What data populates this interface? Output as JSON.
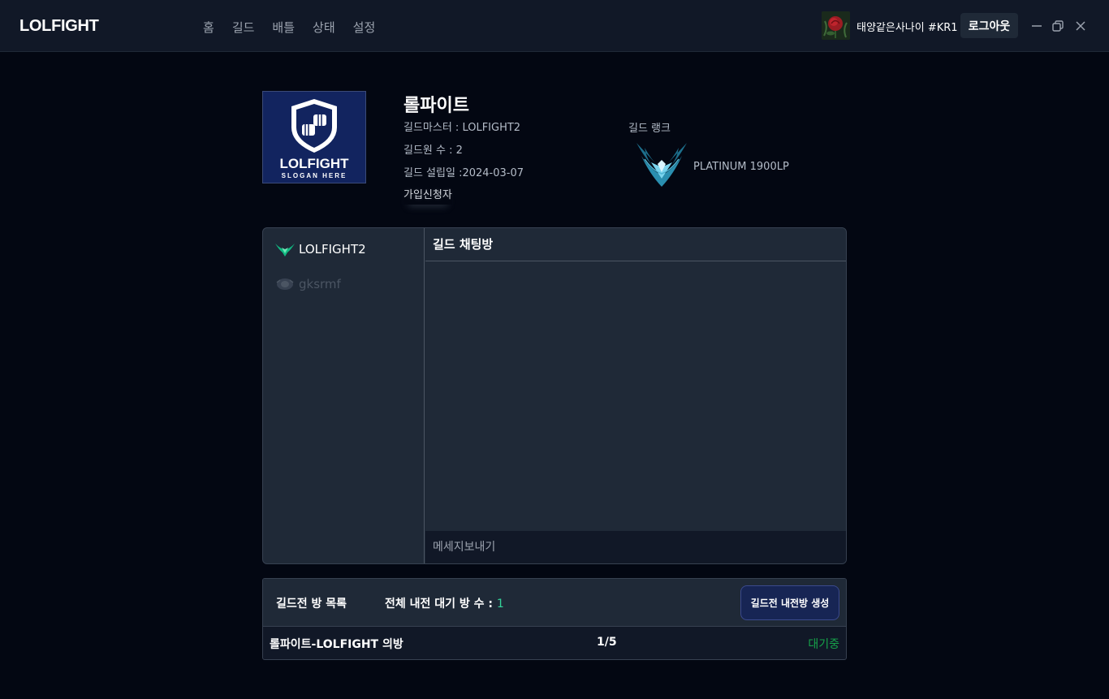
{
  "app": {
    "brand": "LOLFIGHT",
    "nav": [
      "홈",
      "길드",
      "배틀",
      "상태",
      "설정"
    ]
  },
  "user": {
    "name": "태양같은사나이 #KR1",
    "logout_label": "로그아웃"
  },
  "guild": {
    "name": "롤파이트",
    "master": "길드마스터 : LOLFIGHT2",
    "member_count": "길드원 수 : 2",
    "founded": "길드 설립일 :2024-03-07",
    "apply_label": "가입신청자",
    "logo_title": "LOLFIGHT",
    "logo_slogan": "SLOGAN HERE",
    "rank_label": "길드 랭크",
    "rank_value": "PLATINUM 1900LP"
  },
  "members": [
    {
      "name": "LOLFIGHT2",
      "status": "online"
    },
    {
      "name": "gksrmf",
      "status": "offline"
    }
  ],
  "chat": {
    "title": "길드 채팅방",
    "input_placeholder": "메세지보내기"
  },
  "matches": {
    "title": "길드전 방 목록",
    "waiting_label": "전체 내전 대기 방 수 :",
    "waiting_count": "1",
    "create_label": "길드전 내전방 생성",
    "rows": [
      {
        "name": "롤파이트-LOLFIGHT 의방",
        "count": "1/5",
        "status": "대기중"
      }
    ]
  },
  "colors": {
    "background": "#030712",
    "topbar": "#111827",
    "panel": "#1f2937",
    "accent_green": "#34d399",
    "status_green": "#16a34a",
    "create_button": "#172554"
  }
}
